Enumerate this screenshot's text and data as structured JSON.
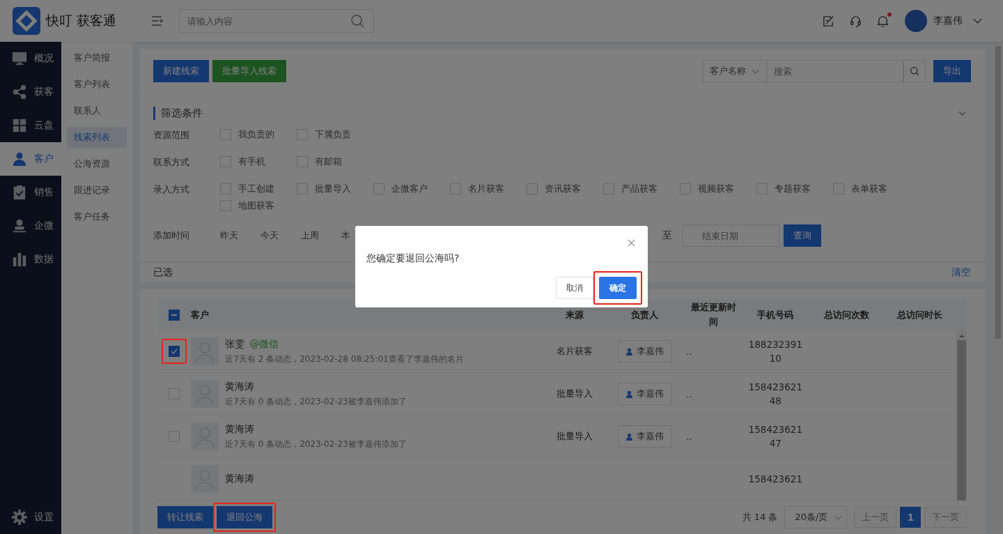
{
  "brand": {
    "name": "快叮 获客通"
  },
  "topbar": {
    "search_placeholder": "请输入内容",
    "notification_dot": true,
    "user": "李嘉伟"
  },
  "nav": [
    {
      "label": "概况",
      "selected": false
    },
    {
      "label": "获客",
      "selected": false
    },
    {
      "label": "云盘",
      "selected": false
    },
    {
      "label": "客户",
      "selected": true
    },
    {
      "label": "销售",
      "selected": false
    },
    {
      "label": "企微",
      "selected": false
    },
    {
      "label": "数据",
      "selected": false
    }
  ],
  "nav_bottom": {
    "label": "设置",
    "selected": false
  },
  "subnav": [
    {
      "label": "客户简报",
      "selected": false
    },
    {
      "label": "客户列表",
      "selected": false
    },
    {
      "label": "联系人",
      "selected": false
    },
    {
      "label": "线索列表",
      "selected": true
    },
    {
      "label": "公海资源",
      "selected": false
    },
    {
      "label": "跟进记录",
      "selected": false
    },
    {
      "label": "客户任务",
      "selected": false
    }
  ],
  "toolbar": {
    "buttons": [
      {
        "label": "新建线索",
        "kind": "primary"
      },
      {
        "label": "批量导入线索",
        "kind": "success"
      }
    ],
    "search_scope": "客户名称",
    "search_placeholder": "搜索",
    "export": "导出"
  },
  "filters": {
    "title": "筛选条件",
    "groups": [
      {
        "label": "资源范围",
        "options": [
          {
            "label": "我负责的",
            "checked": false
          },
          {
            "label": "下属负责",
            "checked": false
          }
        ]
      },
      {
        "label": "联系方式",
        "options": [
          {
            "label": "有手机",
            "checked": false
          },
          {
            "label": "有邮箱",
            "checked": false
          }
        ]
      },
      {
        "label": "录入方式",
        "options": [
          {
            "label": "手工创建",
            "checked": false
          },
          {
            "label": "批量导入",
            "checked": false
          },
          {
            "label": "企微客户",
            "checked": false
          },
          {
            "label": "名片获客",
            "checked": false
          },
          {
            "label": "资讯获客",
            "checked": false
          },
          {
            "label": "产品获客",
            "checked": false
          },
          {
            "label": "视频获客",
            "checked": false
          },
          {
            "label": "专题获客",
            "checked": false
          },
          {
            "label": "表单获客",
            "checked": false
          },
          {
            "label": "地图获客",
            "checked": false
          }
        ]
      }
    ],
    "time": {
      "label": "添加时间",
      "options": [
        "昨天",
        "今天",
        "上周",
        "本"
      ],
      "connector": "至",
      "end_placeholder": "结束日期",
      "query": "查询"
    }
  },
  "selection": {
    "label": "已选",
    "clear": "清空"
  },
  "table": {
    "indeterminate": true,
    "columns": [
      "客户",
      "来源",
      "负责人",
      "最近更新时间",
      "手机号码",
      "总访问次数",
      "总访问时长"
    ],
    "rows": [
      {
        "name": "张雯",
        "tag": "@微信",
        "activity": "近7天有 2 条动态，2023-02-28 08:25:01查看了李嘉伟的名片",
        "source": "名片获客",
        "owner": "李嘉伟",
        "updated": "..",
        "phone": "18823239110",
        "checked": true,
        "highlighted": true
      },
      {
        "name": "黄海涛",
        "activity": "近7天有 0 条动态，2023-02-23被李嘉伟添加了",
        "source": "批量导入",
        "owner": "李嘉伟",
        "updated": "..",
        "phone": "15842362148",
        "checked": false,
        "highlighted": false
      },
      {
        "name": "黄海涛",
        "activity": "近7天有 0 条动态，2023-02-23被李嘉伟添加了",
        "source": "批量导入",
        "owner": "李嘉伟",
        "updated": "..",
        "phone": "15842362147",
        "checked": false,
        "highlighted": false
      },
      {
        "name": "黄海涛",
        "phone": "158423621"
      }
    ]
  },
  "footer": {
    "buttons": [
      {
        "label": "转让线索",
        "highlighted": false
      },
      {
        "label": "退回公海",
        "highlighted": true
      }
    ],
    "total": "共 14 条",
    "page_size": "20条/页",
    "prev": "上一页",
    "prev_disabled": true,
    "pages": [
      {
        "label": "1",
        "selected": true
      }
    ],
    "next": "下一页",
    "next_disabled": true
  },
  "dialog": {
    "message": "您确定要退回公海吗?",
    "buttons": [
      {
        "label": "取消",
        "kind": "default",
        "highlighted": false
      },
      {
        "label": "确定",
        "kind": "primary",
        "highlighted": true
      }
    ]
  }
}
